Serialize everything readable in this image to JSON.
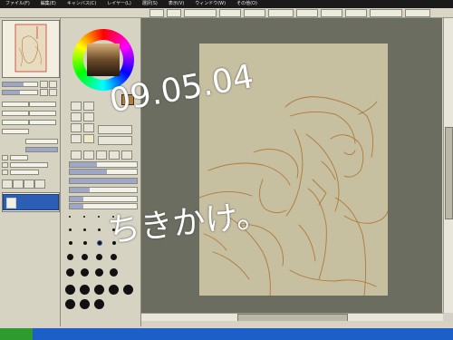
{
  "menubar": {
    "items": [
      "ファイル(F)",
      "編集(E)",
      "キャンバス(C)",
      "レイヤー(L)",
      "選択(S)",
      "表示(V)",
      "ウィンドウ(W)",
      "その他(O)"
    ]
  },
  "toolbar": {
    "select_value": "",
    "zoom_label": "",
    "items": [
      "",
      "",
      "",
      ""
    ]
  },
  "navigator": {
    "zoom": "",
    "angle": ""
  },
  "layer_panel": {
    "mode_label": "",
    "opacity_label": "",
    "layer_name": ""
  },
  "color": {
    "current": "#b27c3c",
    "hue_wheel": true
  },
  "tool_panel": {
    "brush_size_label": "",
    "density_label": ""
  },
  "statusbar": {
    "text": ""
  },
  "overlay": {
    "date": "09.05.04",
    "caption": "ちきかけ。"
  },
  "colors": {
    "paper": "#c6bfa0",
    "sketch_line": "#b07a3a",
    "canvas_bg": "#6b6d60",
    "panel_bg": "#d6d3c3"
  }
}
